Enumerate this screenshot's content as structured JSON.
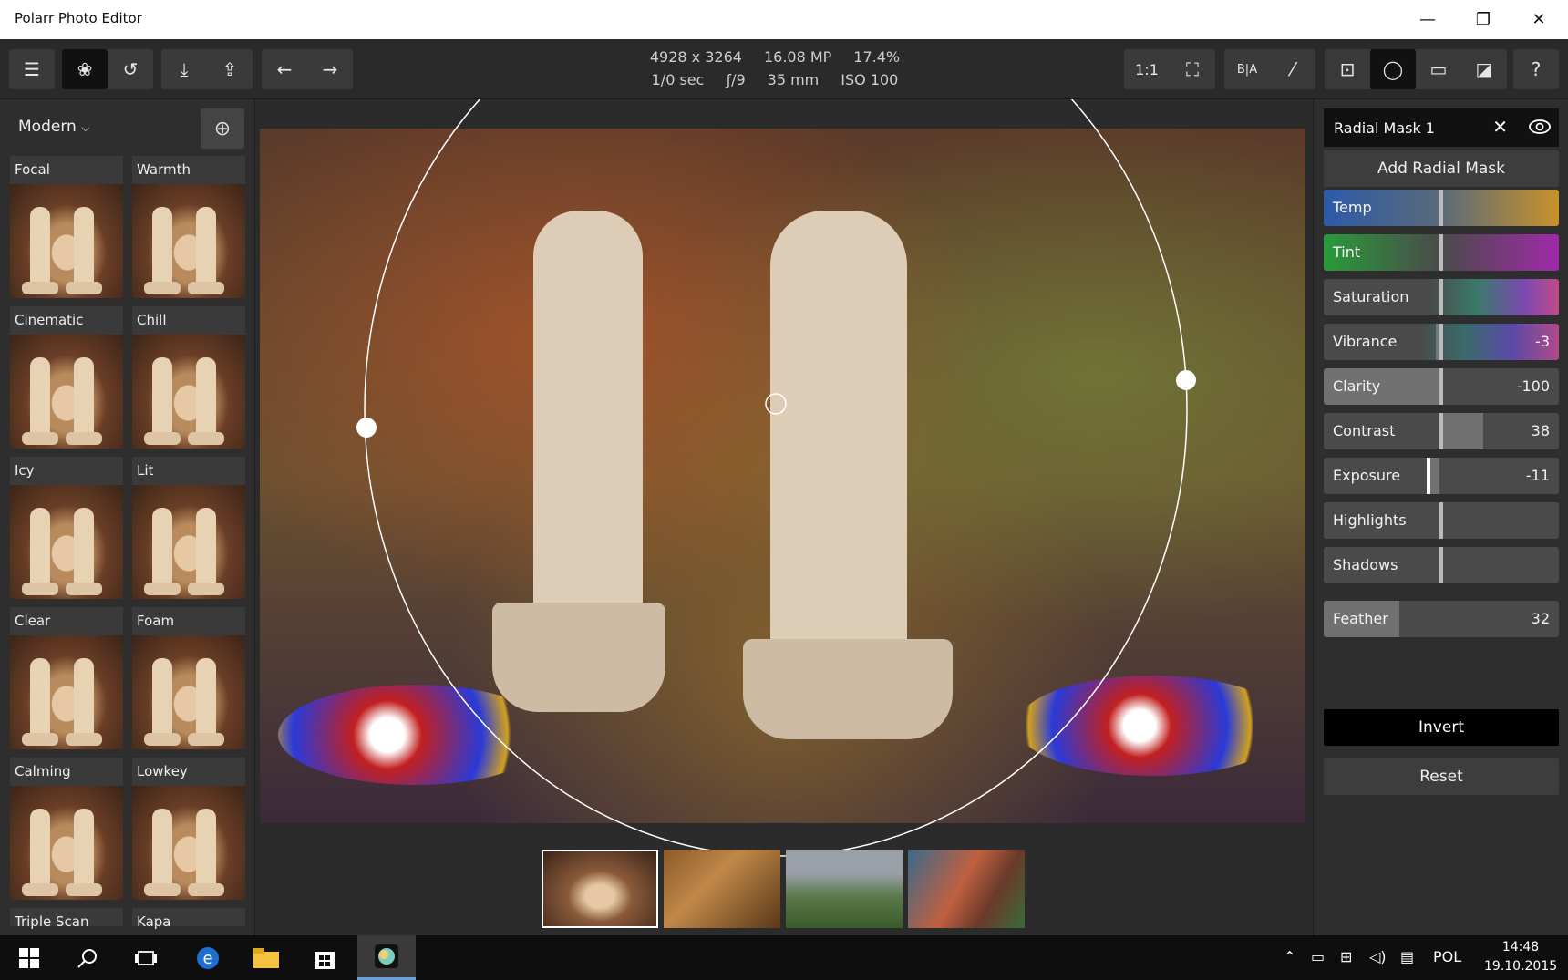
{
  "window": {
    "title": "Polarr Photo Editor",
    "minimize": "—",
    "maximize": "❐",
    "close": "✕"
  },
  "meta": {
    "dimensions": "4928 x 3264",
    "megapixels": "16.08 MP",
    "zoom": "17.4%",
    "shutter": "1/0 sec",
    "aperture": "ƒ/9",
    "focal": "35 mm",
    "iso": "ISO 100"
  },
  "toolbar": {
    "menu_icon": "☰",
    "filters_icon": "❀",
    "history_icon": "↺",
    "save_icon": "⤓",
    "share_icon": "⇪",
    "undo_icon": "←",
    "redo_icon": "→",
    "oneone": "1:1",
    "fit_icon": "⛶",
    "compare_icon": "B|A",
    "split_icon": "⁄",
    "crop_icon": "⊡",
    "radial_icon": "◯",
    "gradient_icon": "▭",
    "brush_icon": "◪",
    "help_icon": "?"
  },
  "presets": {
    "category": "Modern",
    "caret": "⌵",
    "add_icon": "⊕",
    "items": [
      "Focal",
      "Warmth",
      "Cinematic",
      "Chill",
      "Icy",
      "Lit",
      "Clear",
      "Foam",
      "Calming",
      "Lowkey",
      "Triple Scan",
      "Kapa"
    ]
  },
  "mask": {
    "title": "Radial Mask 1",
    "close": "✕",
    "add": "Add Radial Mask",
    "sliders": [
      {
        "name": "Temp",
        "value": "",
        "level": 0
      },
      {
        "name": "Tint",
        "value": "",
        "level": 0
      },
      {
        "name": "Saturation",
        "value": "",
        "level": 0
      },
      {
        "name": "Vibrance",
        "value": "-3",
        "level": -3
      },
      {
        "name": "Clarity",
        "value": "-100",
        "level": -100
      },
      {
        "name": "Contrast",
        "value": "38",
        "level": 38
      },
      {
        "name": "Exposure",
        "value": "-11",
        "level": -11
      },
      {
        "name": "Highlights",
        "value": "",
        "level": 0
      },
      {
        "name": "Shadows",
        "value": "",
        "level": 0
      }
    ],
    "feather": {
      "name": "Feather",
      "value": "32",
      "level": 32
    },
    "invert": "Invert",
    "reset": "Reset"
  },
  "taskbar": {
    "lang": "POL",
    "time": "14:48",
    "date": "19.10.2015"
  }
}
